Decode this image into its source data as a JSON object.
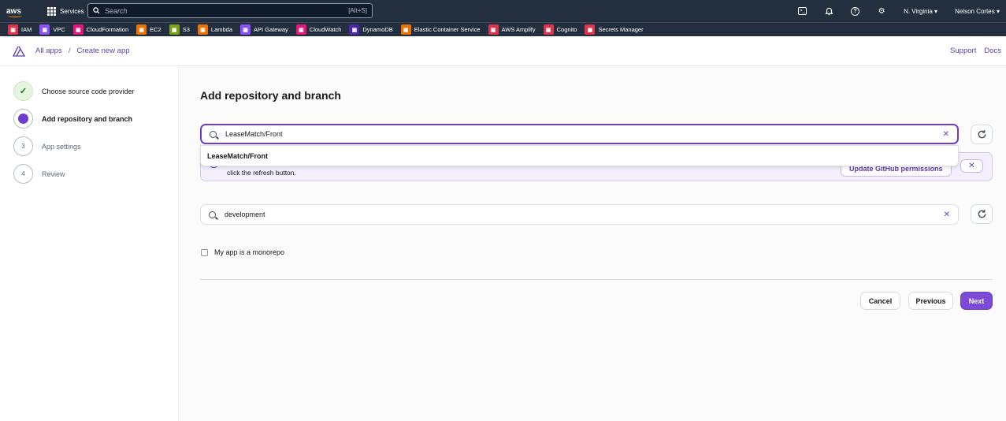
{
  "topnav": {
    "logo": "aws",
    "services_label": "Services",
    "search_placeholder": "Search",
    "search_shortcut": "[Alt+S]",
    "region": "N. Virginia ▾",
    "user": "Nelson Cortes ▾"
  },
  "favorites": [
    {
      "label": "IAM",
      "color": "#dd344c",
      "icon": "iam-icon"
    },
    {
      "label": "VPC",
      "color": "#8c4fff",
      "icon": "vpc-icon"
    },
    {
      "label": "CloudFormation",
      "color": "#e7157b",
      "icon": "cloudformation-icon"
    },
    {
      "label": "EC2",
      "color": "#ed7100",
      "icon": "ec2-icon"
    },
    {
      "label": "S3",
      "color": "#7aa116",
      "icon": "s3-icon"
    },
    {
      "label": "Lambda",
      "color": "#ed7100",
      "icon": "lambda-icon"
    },
    {
      "label": "API Gateway",
      "color": "#8c4fff",
      "icon": "api-gateway-icon"
    },
    {
      "label": "CloudWatch",
      "color": "#e7157b",
      "icon": "cloudwatch-icon"
    },
    {
      "label": "DynamoDB",
      "color": "#4d27aa",
      "icon": "dynamodb-icon"
    },
    {
      "label": "Elastic Container Service",
      "color": "#ed7100",
      "icon": "ecs-icon"
    },
    {
      "label": "AWS Amplify",
      "color": "#dd344c",
      "icon": "amplify-icon"
    },
    {
      "label": "Cognito",
      "color": "#dd344c",
      "icon": "cognito-icon"
    },
    {
      "label": "Secrets Manager",
      "color": "#dd344c",
      "icon": "secrets-manager-icon"
    }
  ],
  "breadcrumb": {
    "root": "All apps",
    "separator": "/",
    "current": "Create new app"
  },
  "toplinks": {
    "support": "Support",
    "docs": "Docs"
  },
  "steps": [
    {
      "num": "✓",
      "label": "Choose source code provider",
      "state": "done"
    },
    {
      "num": "",
      "label": "Add repository and branch",
      "state": "active"
    },
    {
      "num": "3",
      "label": "App settings",
      "state": "pending"
    },
    {
      "num": "4",
      "label": "Review",
      "state": "pending"
    }
  ],
  "main": {
    "title": "Add repository and branch",
    "repo_value": "LeaseMatch/Front",
    "repo_option": "LeaseMatch/Front",
    "alert_text": "click the refresh button.",
    "alert_button": "Update GitHub permissions",
    "branch_value": "development",
    "monorepo_label": "My app is a monorepo",
    "cancel": "Cancel",
    "previous": "Previous",
    "next": "Next"
  },
  "colors": {
    "accent": "#6f3cd1",
    "nav_bg": "#232f3e",
    "success": "#037f0c"
  }
}
